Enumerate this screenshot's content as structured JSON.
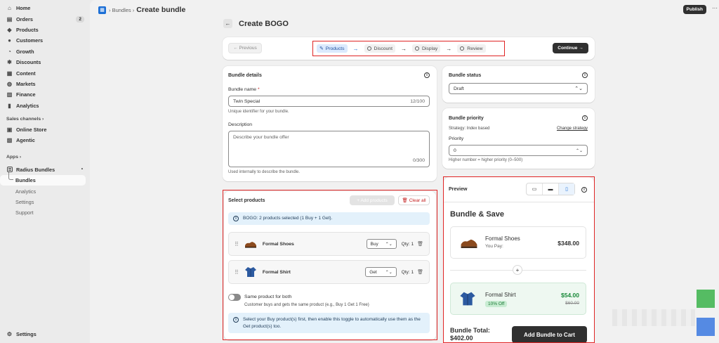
{
  "sidebar": {
    "items": [
      {
        "label": "Home",
        "icon": "home-icon"
      },
      {
        "label": "Orders",
        "icon": "orders-icon",
        "count": "2"
      },
      {
        "label": "Products",
        "icon": "tag-icon"
      },
      {
        "label": "Customers",
        "icon": "person-icon"
      },
      {
        "label": "Growth",
        "icon": "growth-icon"
      },
      {
        "label": "Discounts",
        "icon": "discount-icon"
      },
      {
        "label": "Content",
        "icon": "content-icon"
      },
      {
        "label": "Markets",
        "icon": "globe-icon"
      },
      {
        "label": "Finance",
        "icon": "bank-icon"
      },
      {
        "label": "Analytics",
        "icon": "bar-chart-icon"
      }
    ],
    "sales_channels_label": "Sales channels ›",
    "channels": [
      {
        "label": "Online Store",
        "icon": "store-icon"
      },
      {
        "label": "Agentic",
        "icon": "agentic-icon"
      }
    ],
    "apps_label": "Apps ›",
    "app_name": "Radius Bundles",
    "app_dot": "•",
    "app_subitems": [
      "Bundles",
      "Analytics",
      "Settings",
      "Support"
    ],
    "settings_label": "Settings"
  },
  "topbar": {
    "crumb": "› Bundles ›",
    "title": "Create bundle",
    "publish": "Publish",
    "more": "···"
  },
  "page": {
    "back": "←",
    "title": "Create BOGO"
  },
  "stepper": {
    "previous": "← Previous",
    "steps": [
      "Products",
      "Discount",
      "Display",
      "Review"
    ],
    "continue": "Continue →"
  },
  "bundle_details": {
    "title": "Bundle details",
    "name_label": "Bundle name",
    "required_mark": "*",
    "name_value": "Twin Special",
    "name_count": "12/100",
    "name_help": "Unique identifier for your bundle.",
    "desc_label": "Description",
    "desc_placeholder": "Describe your bundle offer",
    "desc_count": "0/300",
    "desc_help": "Used internally to describe the bundle."
  },
  "bundle_status": {
    "title": "Bundle status",
    "value": "Draft"
  },
  "bundle_priority": {
    "title": "Bundle priority",
    "strategy": "Strategy: Index based",
    "change": "Change strategy",
    "priority_label": "Priority",
    "priority_value": "0",
    "help": "Higher number = higher priority (0–500)"
  },
  "select_products": {
    "title": "Select products",
    "add": "+ Add products",
    "clear": "Clear all",
    "banner": "BOGO: 2 products selected (1 Buy + 1 Get).",
    "products": [
      {
        "name": "Formal Shoes",
        "role": "Buy",
        "qty": "Qty: 1"
      },
      {
        "name": "Formal Shirt",
        "role": "Get",
        "qty": "Qty: 1"
      }
    ],
    "toggle_label": "Same product for both",
    "toggle_help": "Customer buys and gets the same product (e.g., Buy 1 Get 1 Free)",
    "info": "Select your Buy product(s) first, then enable this toggle to automatically use them as the Get product(s) too."
  },
  "preview": {
    "title": "Preview",
    "heading": "Bundle & Save",
    "item1_name": "Formal Shoes",
    "item1_sub": "You Pay:",
    "item1_price": "$348.00",
    "plus": "+",
    "item2_name": "Formal Shirt",
    "item2_badge": "10% Off",
    "item2_price": "$54.00",
    "item2_old": "$60.00",
    "total_label": "Bundle Total:",
    "total_value": "$402.00",
    "cta": "Add Bundle to Cart"
  },
  "colors": {
    "accent_blue": "#1c6fd6",
    "highlight_red": "#e02424",
    "price_green": "#1a8a3a"
  }
}
